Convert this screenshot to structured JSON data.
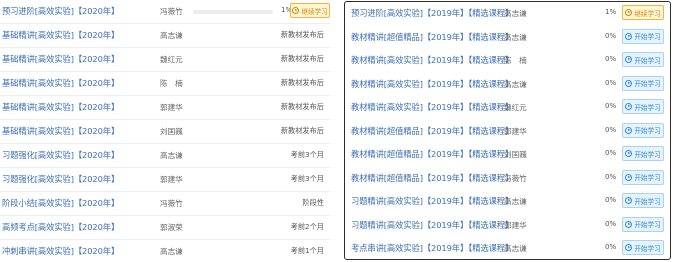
{
  "left_courses": [
    {
      "title": "预习进阶[高效实验]【2020年】",
      "teacher": "冯薇竹",
      "progress_percent": "1%",
      "action": "继续学习",
      "status": ""
    },
    {
      "title": "基础精讲[高效实验]【2020年】",
      "teacher": "高志谦",
      "status": "新教材发布后"
    },
    {
      "title": "基础精讲[高效实验]【2020年】",
      "teacher": "魏红元",
      "status": "新教材发布后"
    },
    {
      "title": "基础精讲[高效实验]【2020年】",
      "teacher": "陈　楠",
      "status": "新教材发布后"
    },
    {
      "title": "基础精讲[高效实验]【2020年】",
      "teacher": "郭建华",
      "status": "新教材发布后"
    },
    {
      "title": "基础精讲[高效实验]【2020年】",
      "teacher": "刘国巍",
      "status": "新教材发布后"
    },
    {
      "title": "习题强化[高效实验]【2020年】",
      "teacher": "高志谦",
      "status": "考前3个月"
    },
    {
      "title": "习题强化[高效实验]【2020年】",
      "teacher": "郭建华",
      "status": "考前3个月"
    },
    {
      "title": "阶段小结[高效实验]【2020年】",
      "teacher": "冯薇竹",
      "status": "阶段性"
    },
    {
      "title": "高频考点[高效实验]【2020年】",
      "teacher": "郭淑荣",
      "status": "考前2个月"
    },
    {
      "title": "冲刺串讲[高效实验]【2020年】",
      "teacher": "高志谦",
      "status": "考前1个月"
    }
  ],
  "right_courses": [
    {
      "title": "预习进阶[高效实验]【2019年】【精选课程】",
      "teacher": "高志谦",
      "progress": "1%",
      "action": "继续学习"
    },
    {
      "title": "教材精讲[超值精品]【2019年】【精选课程】",
      "teacher": "高志谦",
      "progress": "0%",
      "action": "开始学习"
    },
    {
      "title": "教材精讲[高效实验]【2019年】【精选课程】",
      "teacher": "陈　楠",
      "progress": "0%",
      "action": "开始学习"
    },
    {
      "title": "教材精讲[高效实验]【2019年】【精选课程】",
      "teacher": "高志谦",
      "progress": "0%",
      "action": "开始学习"
    },
    {
      "title": "教材精讲[高效实验]【2019年】【精选课程】",
      "teacher": "魏红元",
      "progress": "0%",
      "action": "开始学习"
    },
    {
      "title": "教材精讲[超值精品]【2019年】【精选课程】",
      "teacher": "郭建华",
      "progress": "0%",
      "action": "开始学习"
    },
    {
      "title": "教材精讲[超值精品]【2019年】【精选课程】",
      "teacher": "刘国巍",
      "progress": "0%",
      "action": "开始学习"
    },
    {
      "title": "教材精讲[超值精品]【2019年】【精选课程】",
      "teacher": "冯薇竹",
      "progress": "0%",
      "action": "开始学习"
    },
    {
      "title": "习题精讲[高效实验]【2019年】【精选课程】",
      "teacher": "高志谦",
      "progress": "0%",
      "action": "开始学习"
    },
    {
      "title": "习题精讲[高效实验]【2019年】【精选课程】",
      "teacher": "郭建华",
      "progress": "0%",
      "action": "开始学习"
    },
    {
      "title": "考点串讲[高效实验]【2019年】【精选课程】",
      "teacher": "高志谦",
      "progress": "0%",
      "action": "开始学习"
    }
  ],
  "colors": {
    "link": "#3a6fb0",
    "continue_bg": "#fff6d8",
    "continue_border": "#f0b73a",
    "start_bg": "#e6f3fd",
    "start_text": "#2f8ee0"
  }
}
